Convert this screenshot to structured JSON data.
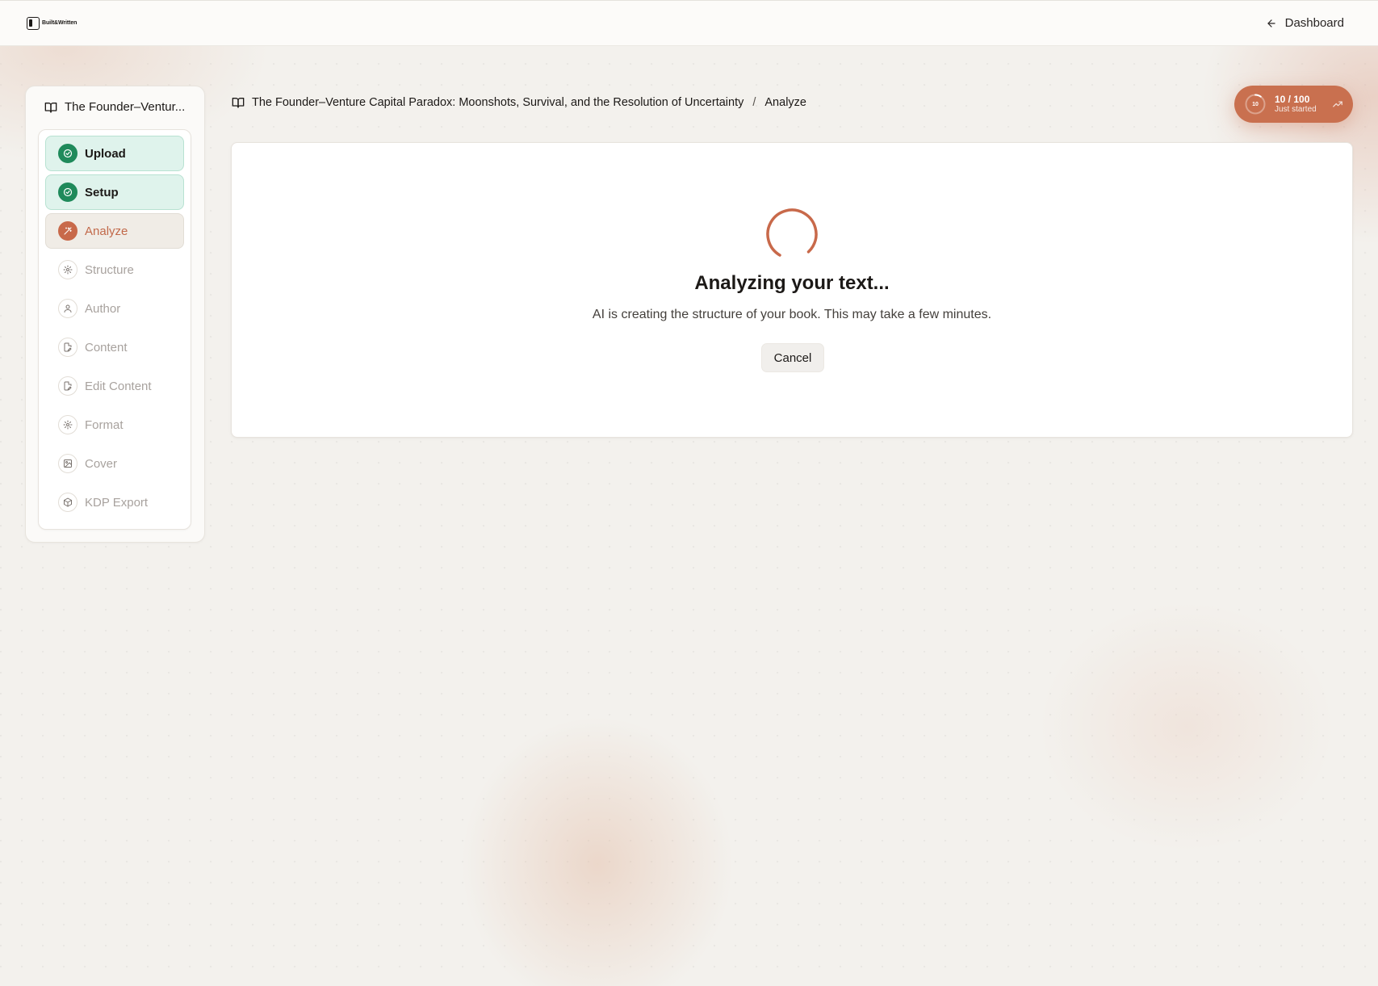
{
  "topbar": {
    "brand": "Built&Written",
    "dashboard_label": "Dashboard"
  },
  "sidebar": {
    "book_title": "The Founder–Ventur...",
    "steps": [
      {
        "label": "Upload",
        "state": "done",
        "icon": "check-circle-icon"
      },
      {
        "label": "Setup",
        "state": "done",
        "icon": "check-circle-icon"
      },
      {
        "label": "Analyze",
        "state": "active",
        "icon": "magic-wand-icon"
      },
      {
        "label": "Structure",
        "state": "pending",
        "icon": "gear-icon"
      },
      {
        "label": "Author",
        "state": "pending",
        "icon": "user-icon"
      },
      {
        "label": "Content",
        "state": "pending",
        "icon": "document-edit-icon"
      },
      {
        "label": "Edit Content",
        "state": "pending",
        "icon": "document-edit-icon"
      },
      {
        "label": "Format",
        "state": "pending",
        "icon": "gear-icon"
      },
      {
        "label": "Cover",
        "state": "pending",
        "icon": "image-icon"
      },
      {
        "label": "KDP Export",
        "state": "pending",
        "icon": "package-icon"
      }
    ]
  },
  "breadcrumb": {
    "book_title": "The Founder–Venture Capital Paradox: Moonshots, Survival, and the Resolution of Uncertainty",
    "separator": "/",
    "current": "Analyze"
  },
  "progress": {
    "ring_value": "10",
    "score": "10 / 100",
    "status": "Just started",
    "fraction": 0.1
  },
  "main": {
    "heading": "Analyzing your text...",
    "subtext": "AI is creating the structure of your book. This may take a few minutes.",
    "cancel_label": "Cancel"
  },
  "colors": {
    "accent": "#c8694a",
    "success": "#1f8a5b",
    "success_bg": "#dff3ec"
  }
}
